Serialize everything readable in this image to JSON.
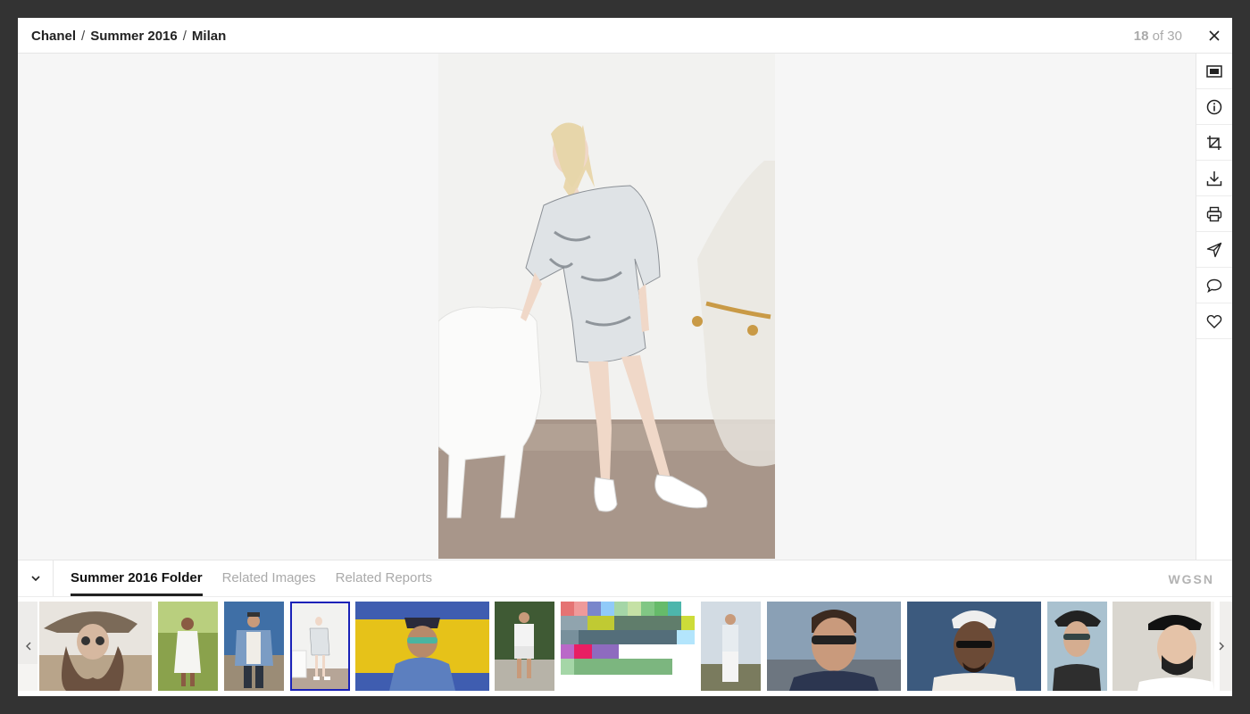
{
  "header": {
    "breadcrumb": [
      "Chanel",
      "Summer 2016",
      "Milan"
    ],
    "counter_current": "18",
    "counter_suffix": "of 30"
  },
  "toolbar": {
    "tools": [
      "fullscreen-icon",
      "info-icon",
      "crop-icon",
      "download-icon",
      "print-icon",
      "send-icon",
      "comment-icon",
      "heart-icon"
    ]
  },
  "tabs": [
    "Summer 2016 Folder",
    "Related Images",
    "Related Reports"
  ],
  "active_tab": "Summer 2016 Folder",
  "brand": "WGSN",
  "thumbnails": {
    "count": 15,
    "selected_index": 4
  },
  "colors": {
    "selected_outline": "#1a22b8",
    "backdrop": "#333333",
    "viewer_bg": "#f6f6f6"
  }
}
